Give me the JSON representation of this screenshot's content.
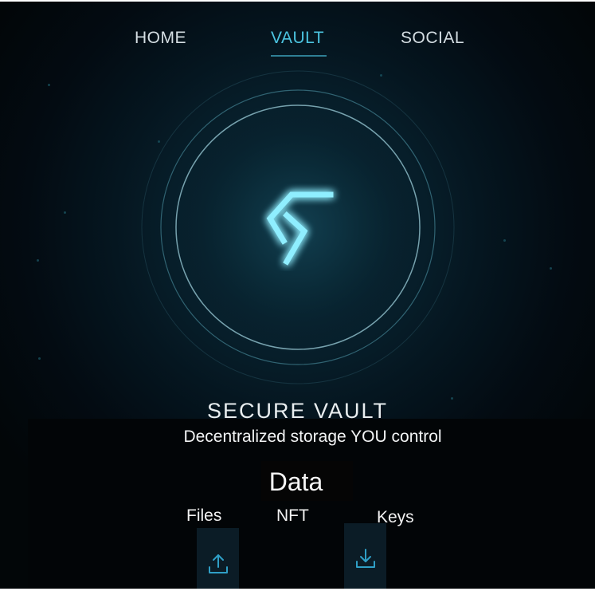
{
  "nav": {
    "items": [
      {
        "label": "HOME",
        "active": false
      },
      {
        "label": "VAULT",
        "active": true
      },
      {
        "label": "SOCIAL",
        "active": false
      }
    ]
  },
  "hero": {
    "logo_icon": "vault-s-logo-icon",
    "title": "SECURE VAULT",
    "subtitle": "Decentralized storage YOU control"
  },
  "data_section": {
    "heading": "Data",
    "tabs": [
      {
        "label": "Files"
      },
      {
        "label": "NFT"
      },
      {
        "label": "Keys"
      }
    ],
    "actions": {
      "upload_icon": "upload-icon",
      "download_icon": "download-icon"
    }
  },
  "colors": {
    "accent": "#4cc4e0",
    "background": "#030b12",
    "glow": "#7fe7ff"
  }
}
